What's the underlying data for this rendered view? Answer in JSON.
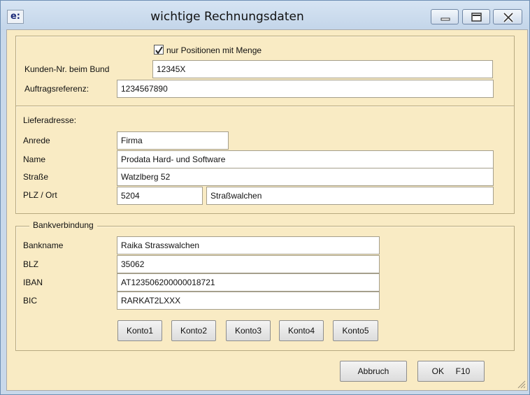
{
  "window": {
    "title": "wichtige Rechnungsdaten",
    "app_icon": "e:"
  },
  "options": {
    "nur_positionen_label": "nur Positionen mit Menge",
    "nur_positionen_checked": true
  },
  "kunde": {
    "kundennr_label": "Kunden-Nr. beim Bund",
    "kundennr_value": "12345X",
    "auftrag_label": "Auftragsreferenz:",
    "auftrag_value": "1234567890"
  },
  "lieferadresse": {
    "heading": "Lieferadresse:",
    "anrede_label": "Anrede",
    "anrede_value": "Firma",
    "name_label": "Name",
    "name_value": "Prodata Hard- und Software",
    "strasse_label": "Straße",
    "strasse_value": "Watzlberg 52",
    "plzort_label": "PLZ / Ort",
    "plz_value": "5204",
    "ort_value": "Straßwalchen"
  },
  "bank": {
    "legend": "Bankverbindung",
    "bankname_label": "Bankname",
    "bankname_value": "Raika Strasswalchen",
    "blz_label": "BLZ",
    "blz_value": "35062",
    "iban_label": "IBAN",
    "iban_value": "AT123506200000018721",
    "bic_label": "BIC",
    "bic_value": "RARKAT2LXXX",
    "konto_buttons": [
      "Konto1",
      "Konto2",
      "Konto3",
      "Konto4",
      "Konto5"
    ]
  },
  "actions": {
    "cancel_label": "Abbruch",
    "ok_label": "OK     F10"
  }
}
